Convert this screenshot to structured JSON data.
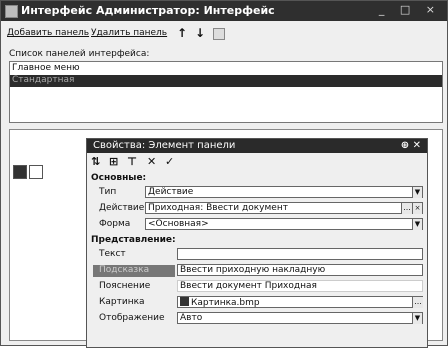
{
  "window": {
    "title": "Интерфейс Администратор: Интерфейс",
    "controls": "_ □ ×"
  },
  "toolbar": {
    "add_panel": "Добавить панель",
    "remove_panel": "Удалить панель",
    "up_icon": "↑",
    "down_icon": "↓"
  },
  "list_label": "Список панелей интерфейса:",
  "panels": [
    "Главное меню",
    "Стандартная"
  ],
  "props": {
    "title": "Свойства: Элемент панели",
    "title_controls": "⊕ ✕",
    "toolbar": {
      "sort": "⇅",
      "cat": "⊞",
      "filter": "⊤",
      "cancel": "✕",
      "ok": "✓"
    },
    "section_main": "Основные:",
    "type_label": "Тип",
    "type_value": "Действие",
    "action_label": "Действие",
    "action_value": "Приходная: Ввести документ",
    "form_label": "Форма",
    "form_value": "<Основная>",
    "section_view": "Представление:",
    "text_label": "Текст",
    "text_value": "",
    "tooltip_label": "Подсказка",
    "tooltip_value": "Ввести приходную накладную",
    "hint_label": "Пояснение",
    "hint_value": "Ввести документ Приходная",
    "picture_label": "Картинка",
    "picture_value": "Картинка.bmp",
    "display_label": "Отображение",
    "display_value": "Авто"
  }
}
